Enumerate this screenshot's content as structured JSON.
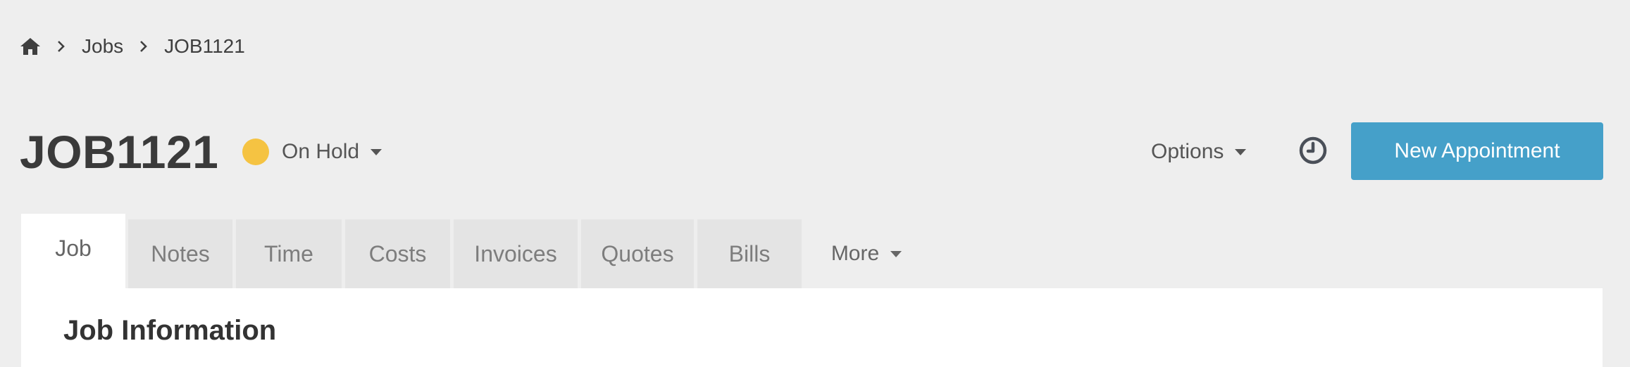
{
  "breadcrumb": {
    "home_icon": "home-icon",
    "items": [
      "Jobs",
      "JOB1121"
    ]
  },
  "header": {
    "title": "JOB1121",
    "status": {
      "label": "On Hold",
      "color": "#f5c342"
    },
    "options_label": "Options",
    "history_icon": "clock-icon",
    "new_appointment_label": "New Appointment",
    "accent_color": "#45a0c9"
  },
  "tabs": [
    {
      "label": "Job",
      "active": true
    },
    {
      "label": "Notes"
    },
    {
      "label": "Time"
    },
    {
      "label": "Costs"
    },
    {
      "label": "Invoices"
    },
    {
      "label": "Quotes"
    },
    {
      "label": "Bills"
    }
  ],
  "more_label": "More",
  "panel": {
    "title": "Job Information"
  }
}
